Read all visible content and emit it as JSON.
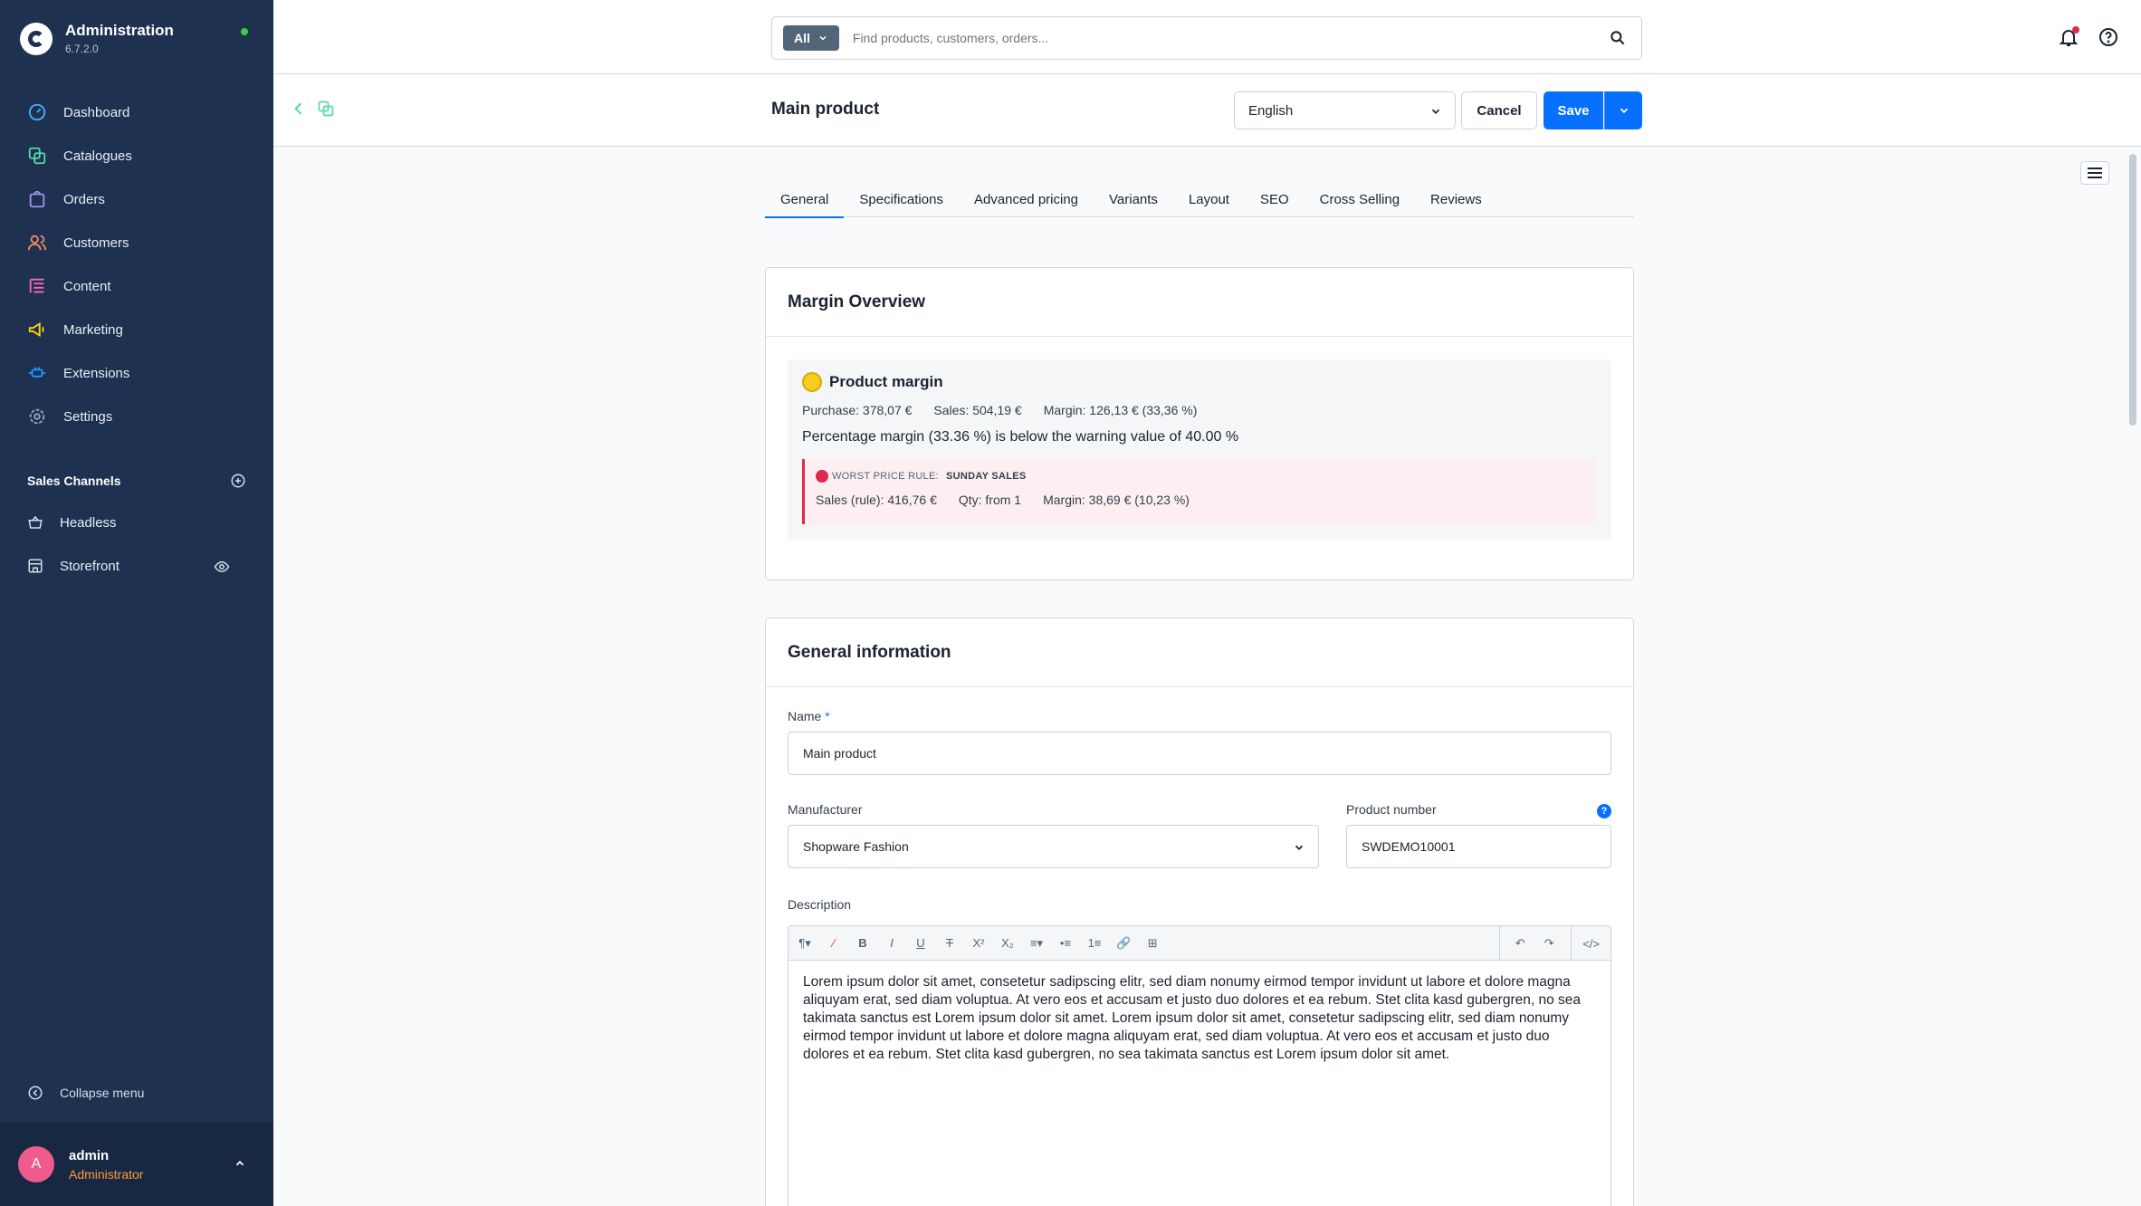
{
  "app": {
    "title": "Administration",
    "version": "6.7.2.0"
  },
  "sidebar": {
    "items": [
      {
        "label": "Dashboard",
        "icon": "dashboard-icon",
        "color": "#47b2f0"
      },
      {
        "label": "Catalogues",
        "icon": "catalogue-icon",
        "color": "#57d9a3"
      },
      {
        "label": "Orders",
        "icon": "orders-icon",
        "color": "#a092f0"
      },
      {
        "label": "Customers",
        "icon": "customers-icon",
        "color": "#f88962"
      },
      {
        "label": "Content",
        "icon": "content-icon",
        "color": "#ff68b4"
      },
      {
        "label": "Marketing",
        "icon": "marketing-icon",
        "color": "#ffd700"
      },
      {
        "label": "Extensions",
        "icon": "extensions-icon",
        "color": "#189eff"
      },
      {
        "label": "Settings",
        "icon": "settings-icon",
        "color": "#9aa8b5"
      }
    ],
    "sales_channels_title": "Sales Channels",
    "sales_channels": [
      {
        "label": "Headless",
        "icon": "basket-icon"
      },
      {
        "label": "Storefront",
        "icon": "storefront-icon"
      }
    ],
    "collapse_label": "Collapse menu",
    "user": {
      "initial": "A",
      "name": "admin",
      "role": "Administrator"
    }
  },
  "topbar": {
    "search_type": "All",
    "search_placeholder": "Find products, customers, orders..."
  },
  "smartbar": {
    "title": "Main product",
    "language": "English",
    "cancel_label": "Cancel",
    "save_label": "Save"
  },
  "tabs": [
    {
      "label": "General",
      "active": true
    },
    {
      "label": "Specifications",
      "active": false
    },
    {
      "label": "Advanced pricing",
      "active": false
    },
    {
      "label": "Variants",
      "active": false
    },
    {
      "label": "Layout",
      "active": false
    },
    {
      "label": "SEO",
      "active": false
    },
    {
      "label": "Cross Selling",
      "active": false
    },
    {
      "label": "Reviews",
      "active": false
    }
  ],
  "margin_overview": {
    "title": "Margin Overview",
    "product_margin_title": "Product margin",
    "purchase": "Purchase: 378,07 €",
    "sales": "Sales: 504,19 €",
    "margin": "Margin: 126,13 € (33,36 %)",
    "warning": "Percentage margin (33.36 %) is below the warning value of 40.00 %",
    "worst_rule_label": "WORST PRICE RULE:",
    "worst_rule_name": "SUNDAY SALES",
    "rule_sales": "Sales (rule): 416,76 €",
    "rule_qty": "Qty: from 1",
    "rule_margin": "Margin: 38,69 € (10,23 %)"
  },
  "general_info": {
    "title": "General information",
    "name_label": "Name",
    "name_required": "*",
    "name_value": "Main product",
    "manufacturer_label": "Manufacturer",
    "manufacturer_value": "Shopware Fashion",
    "product_number_label": "Product number",
    "product_number_value": "SWDEMO10001",
    "help_glyph": "?",
    "description_label": "Description",
    "description_text": "Lorem ipsum dolor sit amet, consetetur sadipscing elitr, sed diam nonumy eirmod tempor invidunt ut labore et dolore magna aliquyam erat, sed diam voluptua. At vero eos et accusam et justo duo dolores et ea rebum. Stet clita kasd gubergren, no sea takimata sanctus est Lorem ipsum dolor sit amet. Lorem ipsum dolor sit amet, consetetur sadipscing elitr, sed diam nonumy eirmod tempor invidunt ut labore et dolore magna aliquyam erat, sed diam voluptua. At vero eos et accusam et justo duo dolores et ea rebum. Stet clita kasd gubergren, no sea takimata sanctus est Lorem ipsum dolor sit amet."
  },
  "colors": {
    "sidebar": "#1e3151",
    "accent": "#0870ff",
    "danger": "#de294c",
    "status_online": "#37d046"
  }
}
